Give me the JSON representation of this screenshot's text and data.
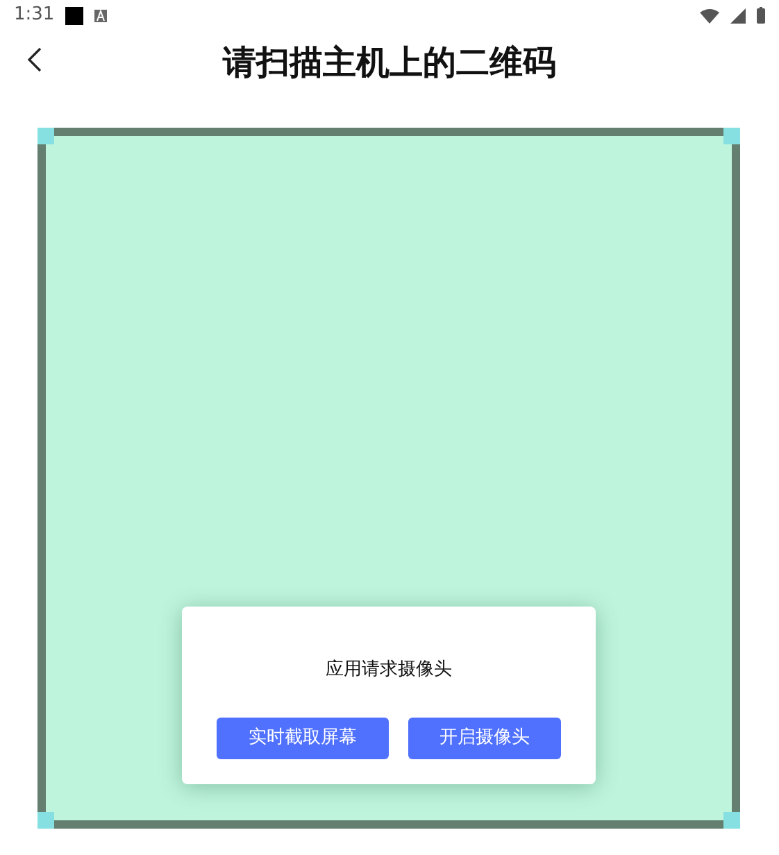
{
  "status_bar": {
    "time": "1:31"
  },
  "header": {
    "title": "请扫描主机上的二维码"
  },
  "dialog": {
    "message": "应用请求摄像头",
    "buttons": [
      {
        "label": "实时截取屏幕"
      },
      {
        "label": "开启摄像头"
      }
    ]
  }
}
